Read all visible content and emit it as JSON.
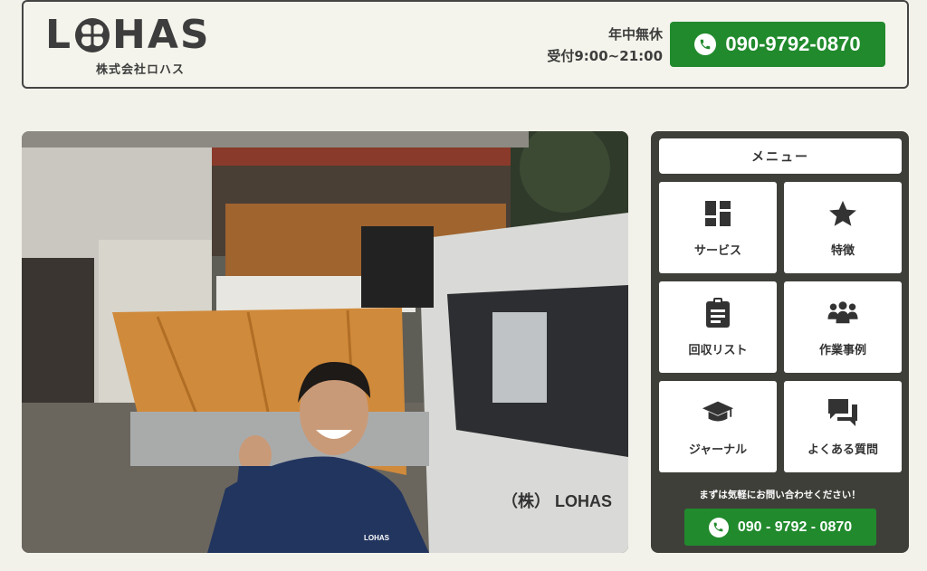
{
  "header": {
    "logo_text_left": "L",
    "logo_text_right": "HAS",
    "company_name": "株式会社ロハス",
    "hours_line1": "年中無休",
    "hours_line2": "受付9:00~21:00",
    "phone": "090-9792-0870"
  },
  "hero": {
    "truck_label": "（株） LOHAS",
    "jacket_logo": "LOHAS"
  },
  "menu": {
    "title": "メニュー",
    "items": [
      {
        "label": "サービス",
        "icon": "grid-icon"
      },
      {
        "label": "特徴",
        "icon": "star-icon"
      },
      {
        "label": "回収リスト",
        "icon": "clipboard-icon"
      },
      {
        "label": "作業事例",
        "icon": "team-icon"
      },
      {
        "label": "ジャーナル",
        "icon": "graduation-cap-icon"
      },
      {
        "label": "よくある質問",
        "icon": "chat-icon"
      }
    ],
    "cta_note": "まずは気軽にお問い合わせください！",
    "cta_phone": "090 - 9792 - 0870"
  },
  "colors": {
    "accent_green": "#218a2d",
    "panel_dark": "#3f3f3a",
    "background": "#f2f2ea"
  }
}
